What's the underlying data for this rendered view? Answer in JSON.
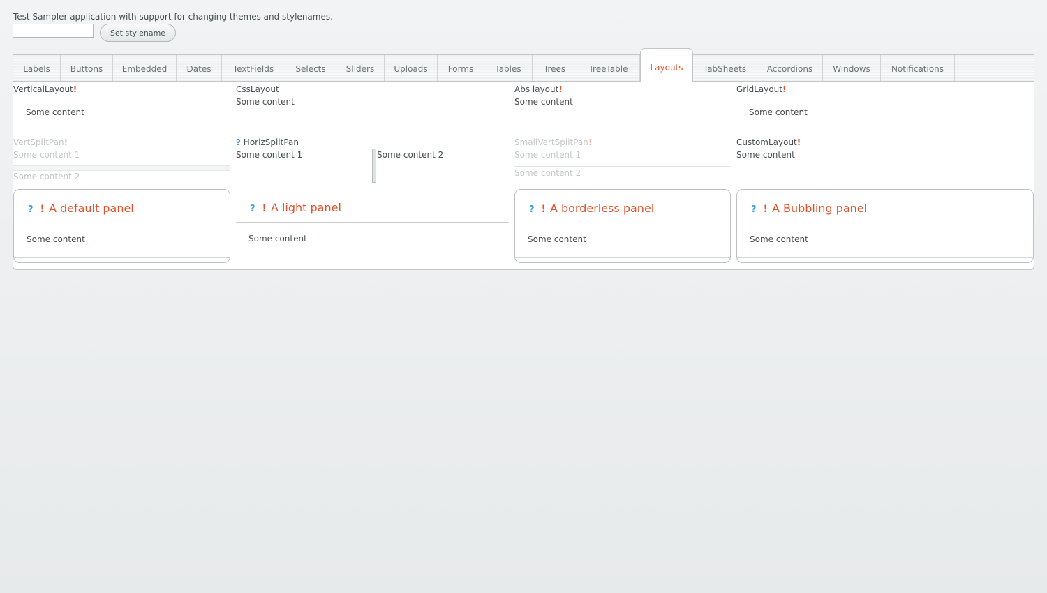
{
  "header": {
    "intro_text": "Test Sampler application with support for changing themes and stylenames.",
    "stylename_value": "",
    "set_stylename_label": "Set stylename"
  },
  "tabs": [
    {
      "label": "Labels"
    },
    {
      "label": "Buttons"
    },
    {
      "label": "Embedded"
    },
    {
      "label": "Dates"
    },
    {
      "label": "TextFields"
    },
    {
      "label": "Selects"
    },
    {
      "label": "Sliders"
    },
    {
      "label": "Uploads"
    },
    {
      "label": "Forms"
    },
    {
      "label": "Tables"
    },
    {
      "label": "Trees"
    },
    {
      "label": "TreeTable"
    },
    {
      "label": "Layouts",
      "selected": true
    },
    {
      "label": "TabSheets"
    },
    {
      "label": "Accordions"
    },
    {
      "label": "Windows"
    },
    {
      "label": "Notifications"
    }
  ],
  "layouts": {
    "vertical_layout": {
      "caption": "VerticalLayout",
      "required": "!",
      "content": "Some content"
    },
    "css_layout": {
      "caption": "CssLayout",
      "content": "Some content"
    },
    "abs_layout": {
      "caption": "Abs layout",
      "required": "!",
      "content": "Some content"
    },
    "grid_layout": {
      "caption": "GridLayout",
      "required": "!",
      "content": "Some content"
    },
    "vert_split": {
      "caption": "VertSplitPan",
      "required": "!",
      "content1": "Some content 1",
      "content2": "Some content 2"
    },
    "horiz_split": {
      "help": "?",
      "caption": "HorizSplitPan",
      "content1": "Some content 1",
      "content2": "Some content 2"
    },
    "small_vert_split": {
      "caption": "SmallVertSplitPan",
      "required": "!",
      "content1": "Some content 1",
      "content2": "Some content 2"
    },
    "custom_layout": {
      "caption": "CustomLayout",
      "required": "!",
      "content": "Some content"
    }
  },
  "panels": [
    {
      "help": "?",
      "required": "!",
      "caption": "A default panel",
      "content": "Some content"
    },
    {
      "help": "?",
      "required": "!",
      "caption": "A light panel",
      "content": "Some content"
    },
    {
      "help": "?",
      "required": "!",
      "caption": "A borderless panel",
      "content": "Some content"
    },
    {
      "help": "?",
      "required": "!",
      "caption": "A Bubbling panel",
      "content": "Some content"
    }
  ],
  "colors": {
    "accent": "#e4502a",
    "help": "#3a9fd8",
    "text": "#464f52",
    "background": "#e9ecec"
  }
}
